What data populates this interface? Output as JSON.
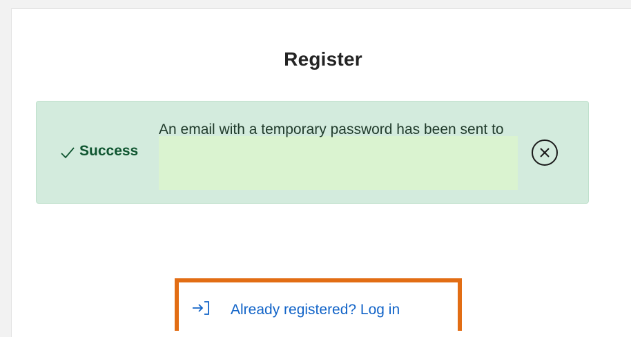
{
  "page": {
    "title": "Register"
  },
  "alert": {
    "icon": "checkmark-icon",
    "label": "Success",
    "message": "An email with a temporary password has been sent to",
    "close_icon": "close-circle-icon"
  },
  "login": {
    "icon": "sign-in-arrow-icon",
    "label": "Already registered? Log in"
  },
  "colors": {
    "success_background": "#d3ebdd",
    "success_text": "#0f5530",
    "link": "#1264c8",
    "highlight_border": "#e26d14"
  }
}
